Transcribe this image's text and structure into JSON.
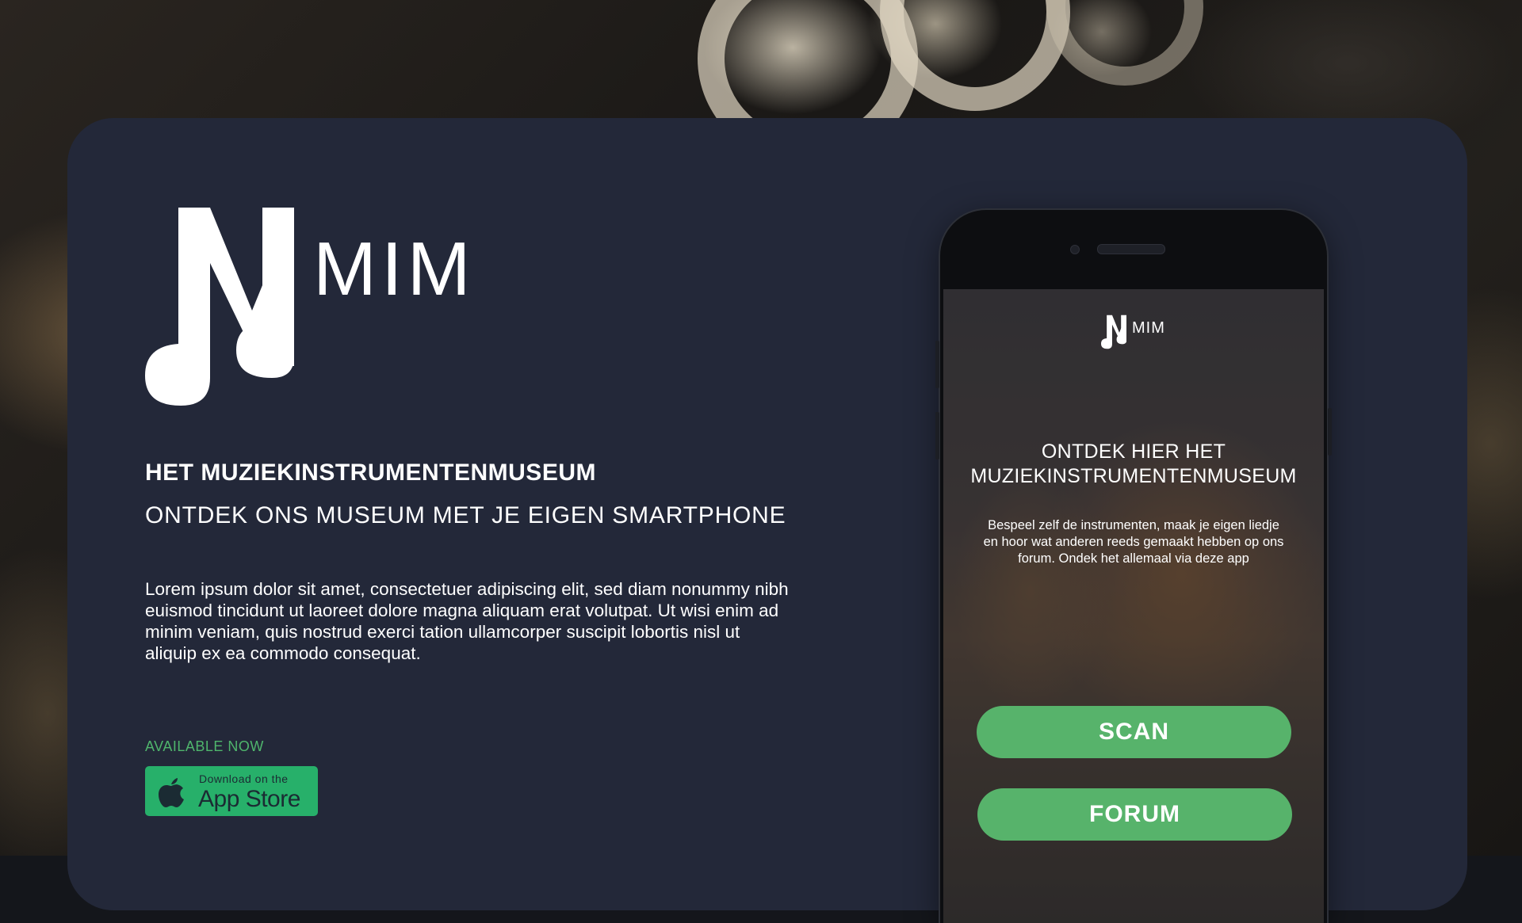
{
  "brand": {
    "name": "MIM",
    "accent": "#57b36b",
    "card_color": "#232839"
  },
  "hero": {
    "title": "HET MUZIEKINSTRUMENTENMUSEUM",
    "subtitle": "ONTDEK ONS MUSEUM MET JE EIGEN SMARTPHONE",
    "body": "Lorem ipsum dolor sit amet, consectetuer adipiscing elit, sed diam nonummy nibh euismod tincidunt ut laoreet dolore magna aliquam erat volutpat. Ut wisi enim ad minim veniam, quis nostrud exerci tation ullamcorper suscipit lobortis nisl ut aliquip ex ea commodo consequat.",
    "available_label": "AVAILABLE NOW"
  },
  "app_store_badge": {
    "small_text": "Download on the",
    "big_text": "App Store",
    "icon": "apple-icon"
  },
  "phone": {
    "logo_text": "MIM",
    "title": "ONTDEK HIER HET MUZIEKINSTRUMENTENMUSEUM",
    "description": "Bespeel zelf de instrumenten, maak je eigen liedje en hoor wat anderen reeds gemaakt hebben op ons forum. Ondek het allemaal via deze app",
    "buttons": [
      {
        "label": "SCAN"
      },
      {
        "label": "FORUM"
      }
    ]
  }
}
